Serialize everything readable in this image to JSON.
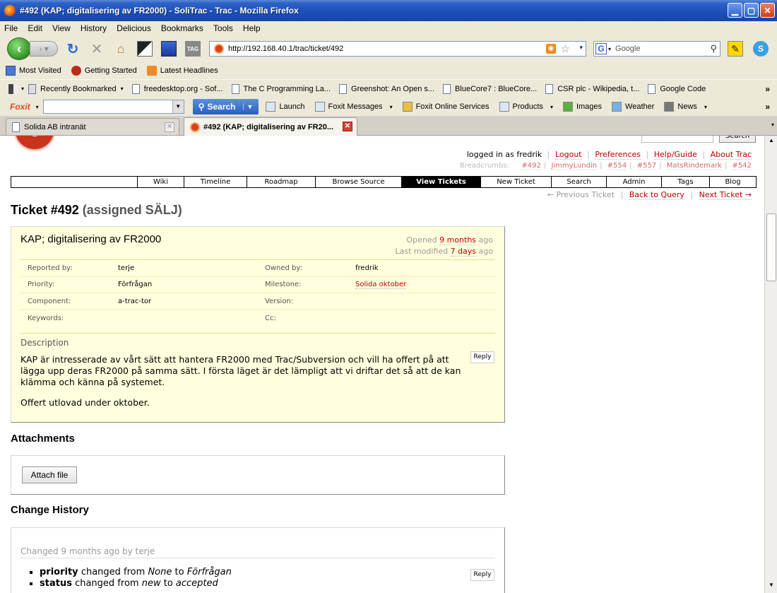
{
  "window": {
    "title": "#492 (KAP; digitalisering av FR2000) - SoliTrac - Trac - Mozilla Firefox"
  },
  "menu": [
    "File",
    "Edit",
    "View",
    "History",
    "Delicious",
    "Bookmarks",
    "Tools",
    "Help"
  ],
  "nav": {
    "url": "http://192.168.40.1/trac/ticket/492",
    "search_placeholder": "Google"
  },
  "bookmarks": [
    "Most Visited",
    "Getting Started",
    "Latest Headlines"
  ],
  "bookmarks2": {
    "recent": "Recently Bookmarked",
    "items": [
      "freedesktop.org - Sof...",
      "The C Programming La...",
      "Greenshot: An Open s...",
      "BlueCore7 : BlueCore...",
      "CSR plc - Wikipedia, t...",
      "Google Code"
    ]
  },
  "foxit": {
    "logo": "Foxit",
    "search_label": "Search",
    "items": [
      "Launch",
      "Foxit Messages",
      "Foxit Online Services",
      "Products",
      "Images",
      "Weather",
      "News"
    ]
  },
  "tabs": [
    {
      "label": "Solida AB intranät"
    },
    {
      "label": "#492 (KAP; digitalisering av FR20..."
    }
  ],
  "trac": {
    "search_button": "Search",
    "metanav": {
      "logged_in": "logged in as fredrik",
      "links": [
        "Logout",
        "Preferences",
        "Help/Guide",
        "About Trac"
      ]
    },
    "breadcrumbs": {
      "label": "Breadcrumbs:",
      "items": [
        "#492",
        "JimmyLundin",
        "#554",
        "#557",
        "MatsRindemark",
        "#542"
      ]
    },
    "mainnav": [
      "Wiki",
      "Timeline",
      "Roadmap",
      "Browse Source",
      "View Tickets",
      "New Ticket",
      "Search",
      "Admin",
      "Tags",
      "Blog"
    ],
    "ctxnav": {
      "prev": "← Previous Ticket",
      "back": "Back to Query",
      "next": "Next Ticket →"
    },
    "ticket": {
      "heading": "Ticket #492",
      "status": "(assigned SÄLJ)",
      "summary": "KAP; digitalisering av FR2000",
      "opened_prefix": "Opened",
      "opened": "9 months",
      "opened_suffix": "ago",
      "modified_prefix": "Last modified",
      "modified": "7 days",
      "modified_suffix": "ago",
      "props": [
        {
          "k1": "Reported by:",
          "v1": "terje",
          "k2": "Owned by:",
          "v2": "fredrik"
        },
        {
          "k1": "Priority:",
          "v1": "Förfrågan",
          "k2": "Milestone:",
          "v2": "Solida oktober"
        },
        {
          "k1": "Component:",
          "v1": "a-trac-tor",
          "k2": "Version:",
          "v2": ""
        },
        {
          "k1": "Keywords:",
          "v1": "",
          "k2": "Cc:",
          "v2": ""
        }
      ],
      "description_label": "Description",
      "description_p1": "KAP är intresserade av vårt sätt att hantera FR2000 med Trac/Subversion och vill ha offert på att lägga upp deras FR2000 på samma sätt. I första läget är det lämpligt att vi driftar det så att de kan klämma och känna på systemet.",
      "description_p2": "Offert utlovad under oktober.",
      "reply": "Reply"
    },
    "attachments": {
      "heading": "Attachments",
      "button": "Attach file"
    },
    "history": {
      "heading": "Change History",
      "changed_prefix": "Changed",
      "changed_when": "9 months",
      "changed_by": "ago by terje",
      "changes": [
        {
          "field": "priority",
          "text1": "changed from",
          "old": "None",
          "text2": "to",
          "new": "Förfrågan"
        },
        {
          "field": "status",
          "text1": "changed from",
          "old": "new",
          "text2": "to",
          "new": "accepted"
        }
      ],
      "reply": "Reply"
    }
  }
}
